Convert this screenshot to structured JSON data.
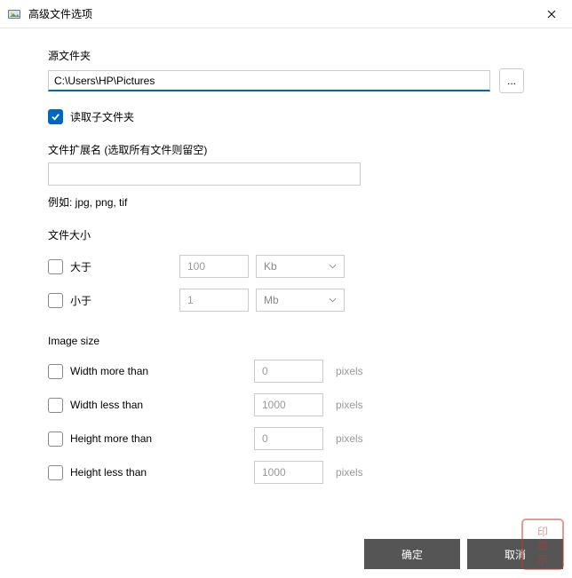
{
  "titlebar": {
    "title": "高级文件选项"
  },
  "source": {
    "label": "源文件夹",
    "path": "C:\\Users\\HP\\Pictures",
    "browse": "...",
    "read_sub_label": "读取子文件夹",
    "read_sub_checked": true
  },
  "ext": {
    "label": "文件扩展名 (选取所有文件则留空)",
    "value": "",
    "hint": "例如: jpg, png, tif"
  },
  "filesize": {
    "label": "文件大小",
    "gt_label": "大于",
    "gt_checked": false,
    "gt_value": "100",
    "gt_unit": "Kb",
    "lt_label": "小于",
    "lt_checked": false,
    "lt_value": "1",
    "lt_unit": "Mb"
  },
  "imgsize": {
    "label": "Image size",
    "unit": "pixels",
    "wmore_label": "Width more than",
    "wmore_checked": false,
    "wmore_value": "0",
    "wless_label": "Width less than",
    "wless_checked": false,
    "wless_value": "1000",
    "hmore_label": "Height more than",
    "hmore_checked": false,
    "hmore_value": "0",
    "hless_label": "Height less than",
    "hless_checked": false,
    "hless_value": "1000"
  },
  "footer": {
    "ok": "确定",
    "cancel": "取消"
  }
}
